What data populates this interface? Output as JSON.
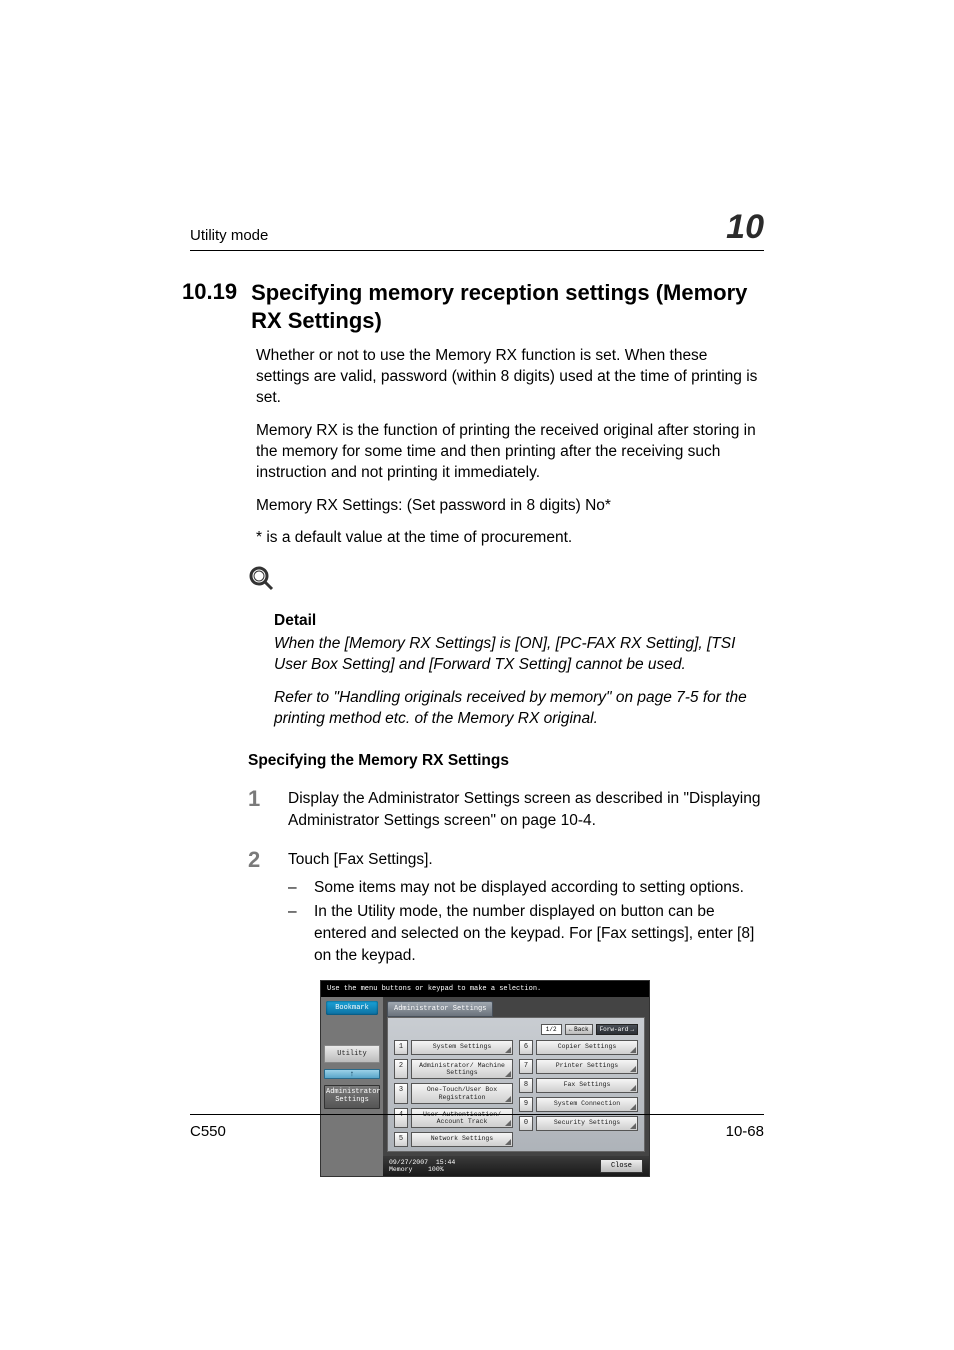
{
  "header": {
    "running_head": "Utility mode",
    "chapter_number": "10"
  },
  "section": {
    "number": "10.19",
    "title": "Specifying memory reception settings (Memory RX Settings)"
  },
  "paragraphs": {
    "p1": "Whether or not to use the Memory RX function is set. When these settings are valid, password (within 8 digits) used at the time of printing is set.",
    "p2": "Memory RX is the function of printing the received original after storing in the memory for some time and then printing after the receiving such instruction and not printing it immediately.",
    "p3": "Memory RX Settings: (Set password in 8 digits) No*",
    "p4": "* is a default value at the time of procurement."
  },
  "detail": {
    "label": "Detail",
    "d1": "When the [Memory RX Settings] is [ON], [PC-FAX RX Setting], [TSI User Box Setting] and [Forward TX Setting] cannot be used.",
    "d2": "Refer to \"Handling originals received by memory\" on page 7-5 for the printing method etc. of the Memory RX original."
  },
  "subheading": "Specifying the Memory RX Settings",
  "steps": {
    "s1_num": "1",
    "s1_text": "Display the Administrator Settings screen as described in \"Displaying Administrator Settings screen\" on page 10-4.",
    "s2_num": "2",
    "s2_text": "Touch [Fax Settings].",
    "s2_sub1": "Some items may not be displayed according to setting options.",
    "s2_sub2": "In the Utility mode, the number displayed on button can be entered and selected on the keypad. For [Fax settings], enter [8] on the keypad."
  },
  "device": {
    "instruction": "Use the menu buttons or keypad to make a selection.",
    "bookmark": "Bookmark",
    "side_utility": "Utility",
    "side_admin_l1": "Administrator",
    "side_admin_l2": "Settings",
    "tab": "Administrator Settings",
    "page_indicator": "1/2",
    "back_label": "Back",
    "forward_label": "Forw-ard",
    "left": [
      {
        "n": "1",
        "label": "System Settings"
      },
      {
        "n": "2",
        "label": "Administrator/ Machine Settings"
      },
      {
        "n": "3",
        "label": "One-Touch/User Box Registration"
      },
      {
        "n": "4",
        "label": "User Authentication/ Account Track"
      },
      {
        "n": "5",
        "label": "Network Settings"
      }
    ],
    "right": [
      {
        "n": "6",
        "label": "Copier Settings"
      },
      {
        "n": "7",
        "label": "Printer Settings"
      },
      {
        "n": "8",
        "label": "Fax Settings"
      },
      {
        "n": "9",
        "label": "System Connection"
      },
      {
        "n": "0",
        "label": "Security Settings"
      }
    ],
    "footer_date": "09/27/2007",
    "footer_time": "15:44",
    "footer_mem_label": "Memory",
    "footer_mem_val": "100%",
    "close": "Close"
  },
  "footer": {
    "model": "C550",
    "page": "10-68"
  },
  "glyphs": {
    "dash": "–",
    "left_arrow": "←",
    "right_arrow": "→",
    "up_arrow": "↑"
  }
}
